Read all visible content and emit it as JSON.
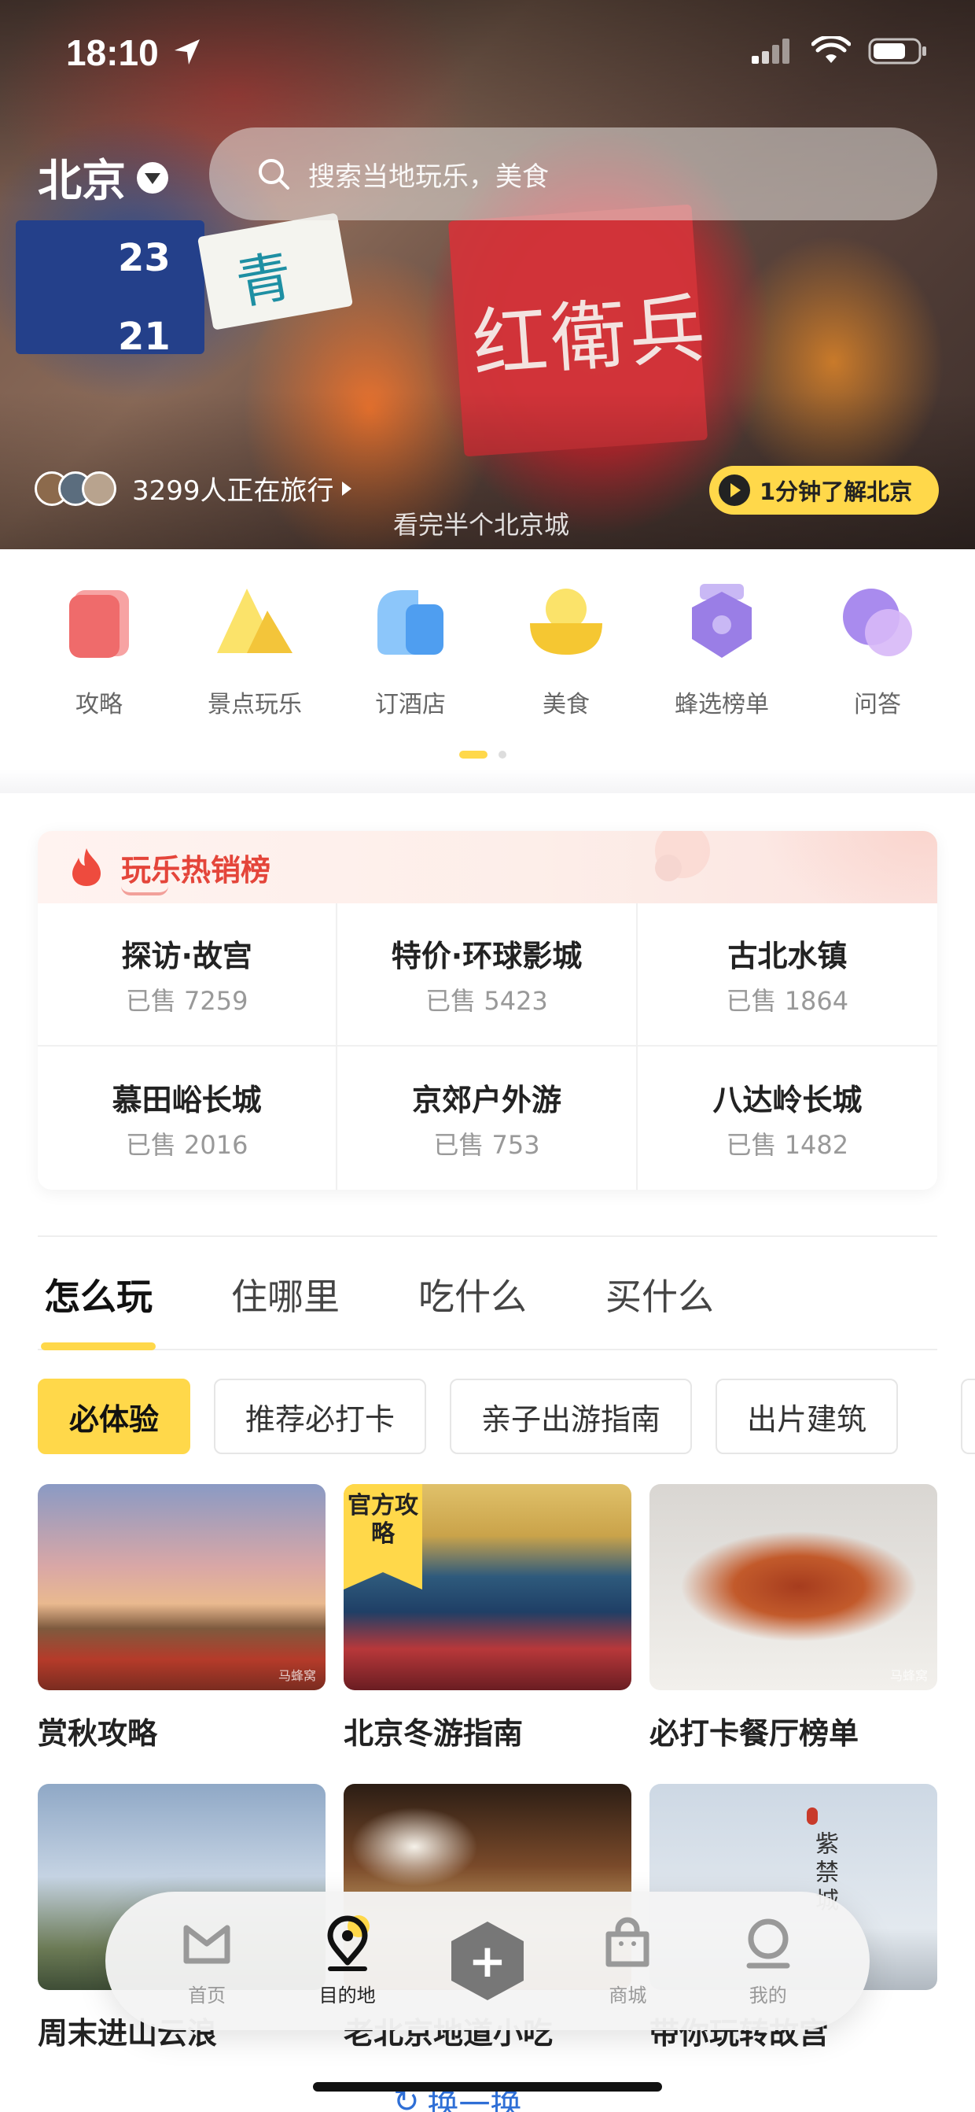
{
  "status_bar": {
    "time": "18:10"
  },
  "header": {
    "city": "北京",
    "search_placeholder": "搜索当地玩乐，美食",
    "travellers_text": "3299人正在旅行",
    "learn_button": "1分钟了解北京",
    "hero_caption": "看完半个北京城",
    "hero_sign_texts": [
      "红衛兵",
      "青",
      "23",
      "21"
    ]
  },
  "categories": [
    {
      "label": "攻略",
      "icon": "strategy-icon",
      "color": "#ef6b6b"
    },
    {
      "label": "景点玩乐",
      "icon": "attractions-icon",
      "color": "#f7d43c"
    },
    {
      "label": "订酒店",
      "icon": "hotel-icon",
      "color": "#5aa8f2"
    },
    {
      "label": "美食",
      "icon": "food-icon",
      "color": "#f7d43c"
    },
    {
      "label": "蜂选榜单",
      "icon": "ranking-icon",
      "color": "#9a7ee6"
    },
    {
      "label": "问答",
      "icon": "qa-icon",
      "color": "#b98ef0"
    }
  ],
  "hot_list": {
    "title": "玩乐热销榜",
    "items": [
      {
        "name": "探访·故宫",
        "sold": "已售 7259"
      },
      {
        "name": "特价·环球影城",
        "sold": "已售 5423"
      },
      {
        "name": "古北水镇",
        "sold": "已售 1864"
      },
      {
        "name": "慕田峪长城",
        "sold": "已售 2016"
      },
      {
        "name": "京郊户外游",
        "sold": "已售 753"
      },
      {
        "name": "八达岭长城",
        "sold": "已售 1482"
      }
    ]
  },
  "tabs": [
    "怎么玩",
    "住哪里",
    "吃什么",
    "买什么"
  ],
  "chips": [
    "必体验",
    "推荐必打卡",
    "亲子出游指南",
    "出片建筑"
  ],
  "cards": [
    {
      "title": "赏秋攻略",
      "badge": "",
      "watermark": "马蜂窝"
    },
    {
      "title": "北京冬游指南",
      "badge": "官方攻略",
      "watermark": ""
    },
    {
      "title": "必打卡餐厅榜单",
      "badge": "",
      "watermark": "马蜂窝"
    },
    {
      "title": "周末进山云浪",
      "badge": "",
      "watermark": ""
    },
    {
      "title": "老北京地道小吃",
      "badge": "",
      "watermark": ""
    },
    {
      "title": "带你玩转故宫",
      "badge": "",
      "watermark": "",
      "art_text": "紫禁城"
    }
  ],
  "bottom_nav": [
    {
      "label": "首页",
      "icon": "home-icon"
    },
    {
      "label": "目的地",
      "icon": "destination-icon"
    },
    {
      "label": "",
      "icon": "add-icon"
    },
    {
      "label": "商城",
      "icon": "shop-bag-icon"
    },
    {
      "label": "我的",
      "icon": "profile-icon"
    }
  ],
  "refresh_label": "换一换",
  "colors": {
    "accent": "#ffd84a",
    "hot_red": "#e4453a"
  }
}
